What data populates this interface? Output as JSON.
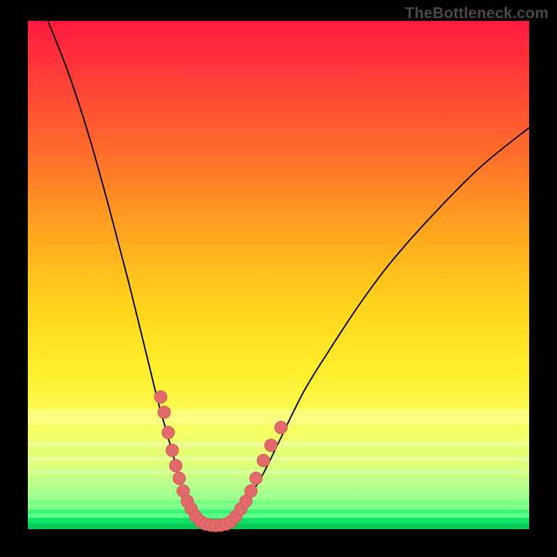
{
  "watermark": "TheBottleneck.com",
  "chart_data": {
    "type": "line",
    "title": "",
    "xlabel": "",
    "ylabel": "",
    "xlim": [
      0,
      100
    ],
    "ylim": [
      0,
      100
    ],
    "grid": false,
    "legend": false,
    "series": [
      {
        "name": "curve-left",
        "x": [
          4,
          8,
          12,
          16,
          20,
          24,
          26,
          28,
          30,
          31,
          32,
          33,
          34,
          35
        ],
        "y": [
          100,
          90,
          78,
          64,
          49,
          33,
          25,
          18,
          11,
          8,
          6,
          4,
          2,
          1
        ]
      },
      {
        "name": "curve-right",
        "x": [
          40,
          42,
          44,
          47,
          50,
          55,
          60,
          66,
          72,
          80,
          90,
          100
        ],
        "y": [
          1,
          3,
          6,
          11,
          17,
          27,
          35,
          44,
          52,
          61,
          71,
          79
        ]
      },
      {
        "name": "floor",
        "x": [
          35,
          36,
          37,
          38,
          39,
          40
        ],
        "y": [
          1,
          0.5,
          0.4,
          0.4,
          0.5,
          1
        ]
      }
    ],
    "markers": [
      {
        "x": 26.5,
        "y": 26
      },
      {
        "x": 27.2,
        "y": 23
      },
      {
        "x": 28.0,
        "y": 19
      },
      {
        "x": 28.8,
        "y": 15.5
      },
      {
        "x": 29.5,
        "y": 12.5
      },
      {
        "x": 30.2,
        "y": 10
      },
      {
        "x": 31.0,
        "y": 7.5
      },
      {
        "x": 31.8,
        "y": 5.5
      },
      {
        "x": 32.6,
        "y": 4
      },
      {
        "x": 33.5,
        "y": 2.5
      },
      {
        "x": 34.5,
        "y": 1.5
      },
      {
        "x": 35.5,
        "y": 1
      },
      {
        "x": 36.5,
        "y": 0.8
      },
      {
        "x": 37.5,
        "y": 0.7
      },
      {
        "x": 38.5,
        "y": 0.8
      },
      {
        "x": 39.5,
        "y": 1
      },
      {
        "x": 40.5,
        "y": 1.5
      },
      {
        "x": 41.5,
        "y": 2.5
      },
      {
        "x": 42.5,
        "y": 4
      },
      {
        "x": 43.5,
        "y": 5.5
      },
      {
        "x": 44.5,
        "y": 7.5
      },
      {
        "x": 45.5,
        "y": 10
      },
      {
        "x": 47.0,
        "y": 13.5
      },
      {
        "x": 48.5,
        "y": 16.5
      },
      {
        "x": 50.5,
        "y": 20
      }
    ],
    "gradient_bands": [
      {
        "color": "#ff1a3f",
        "stop": 0
      },
      {
        "color": "#ffa020",
        "stop": 40
      },
      {
        "color": "#fff030",
        "stop": 70
      },
      {
        "color": "#2fff80",
        "stop": 100
      }
    ]
  }
}
